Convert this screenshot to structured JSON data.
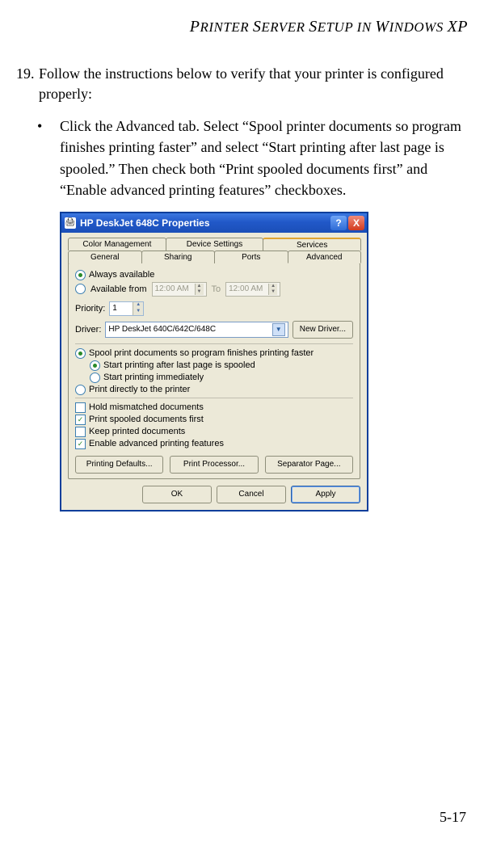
{
  "header_html": "<span class='cap'>P</span>RINTER <span class='cap'>S</span>ERVER <span class='cap'>S</span>ETUP IN <span class='cap'>W</span>INDOWS <span class='cap'>XP</span>",
  "step_number": "19.",
  "step_text": "Follow the instructions below to verify that your printer is configured properly:",
  "bullet_mark": "•",
  "bullet_text": "Click the Advanced tab. Select “Spool printer documents so program finishes printing faster” and select “Start printing after last page is spooled.” Then check both “Print spooled documents first” and “Enable advanced printing features” checkboxes.",
  "page_number": "5-17",
  "dialog": {
    "title": "HP DeskJet 648C Properties",
    "help_glyph": "?",
    "close_glyph": "X",
    "tabs_row1": [
      "Color Management",
      "Device Settings",
      "Services"
    ],
    "tabs_row2": [
      "General",
      "Sharing",
      "Ports",
      "Advanced"
    ],
    "selected_tab": "Advanced",
    "always_available": "Always available",
    "available_from": "Available from",
    "time_from": "12:00 AM",
    "time_to_label": "To",
    "time_to": "12:00 AM",
    "priority_label": "Priority:",
    "priority_value": "1",
    "driver_label": "Driver:",
    "driver_value": "HP DeskJet 640C/642C/648C",
    "new_driver_btn": "New Driver...",
    "spool": "Spool print documents so program finishes printing faster",
    "spool_after": "Start printing after last page is spooled",
    "spool_immediately": "Start printing immediately",
    "print_direct": "Print directly to the printer",
    "hold_mismatched": "Hold mismatched documents",
    "print_spooled_first": "Print spooled documents first",
    "keep_printed": "Keep printed documents",
    "enable_adv": "Enable advanced printing features",
    "btn_defaults": "Printing Defaults...",
    "btn_processor": "Print Processor...",
    "btn_separator": "Separator Page...",
    "btn_ok": "OK",
    "btn_cancel": "Cancel",
    "btn_apply": "Apply"
  }
}
